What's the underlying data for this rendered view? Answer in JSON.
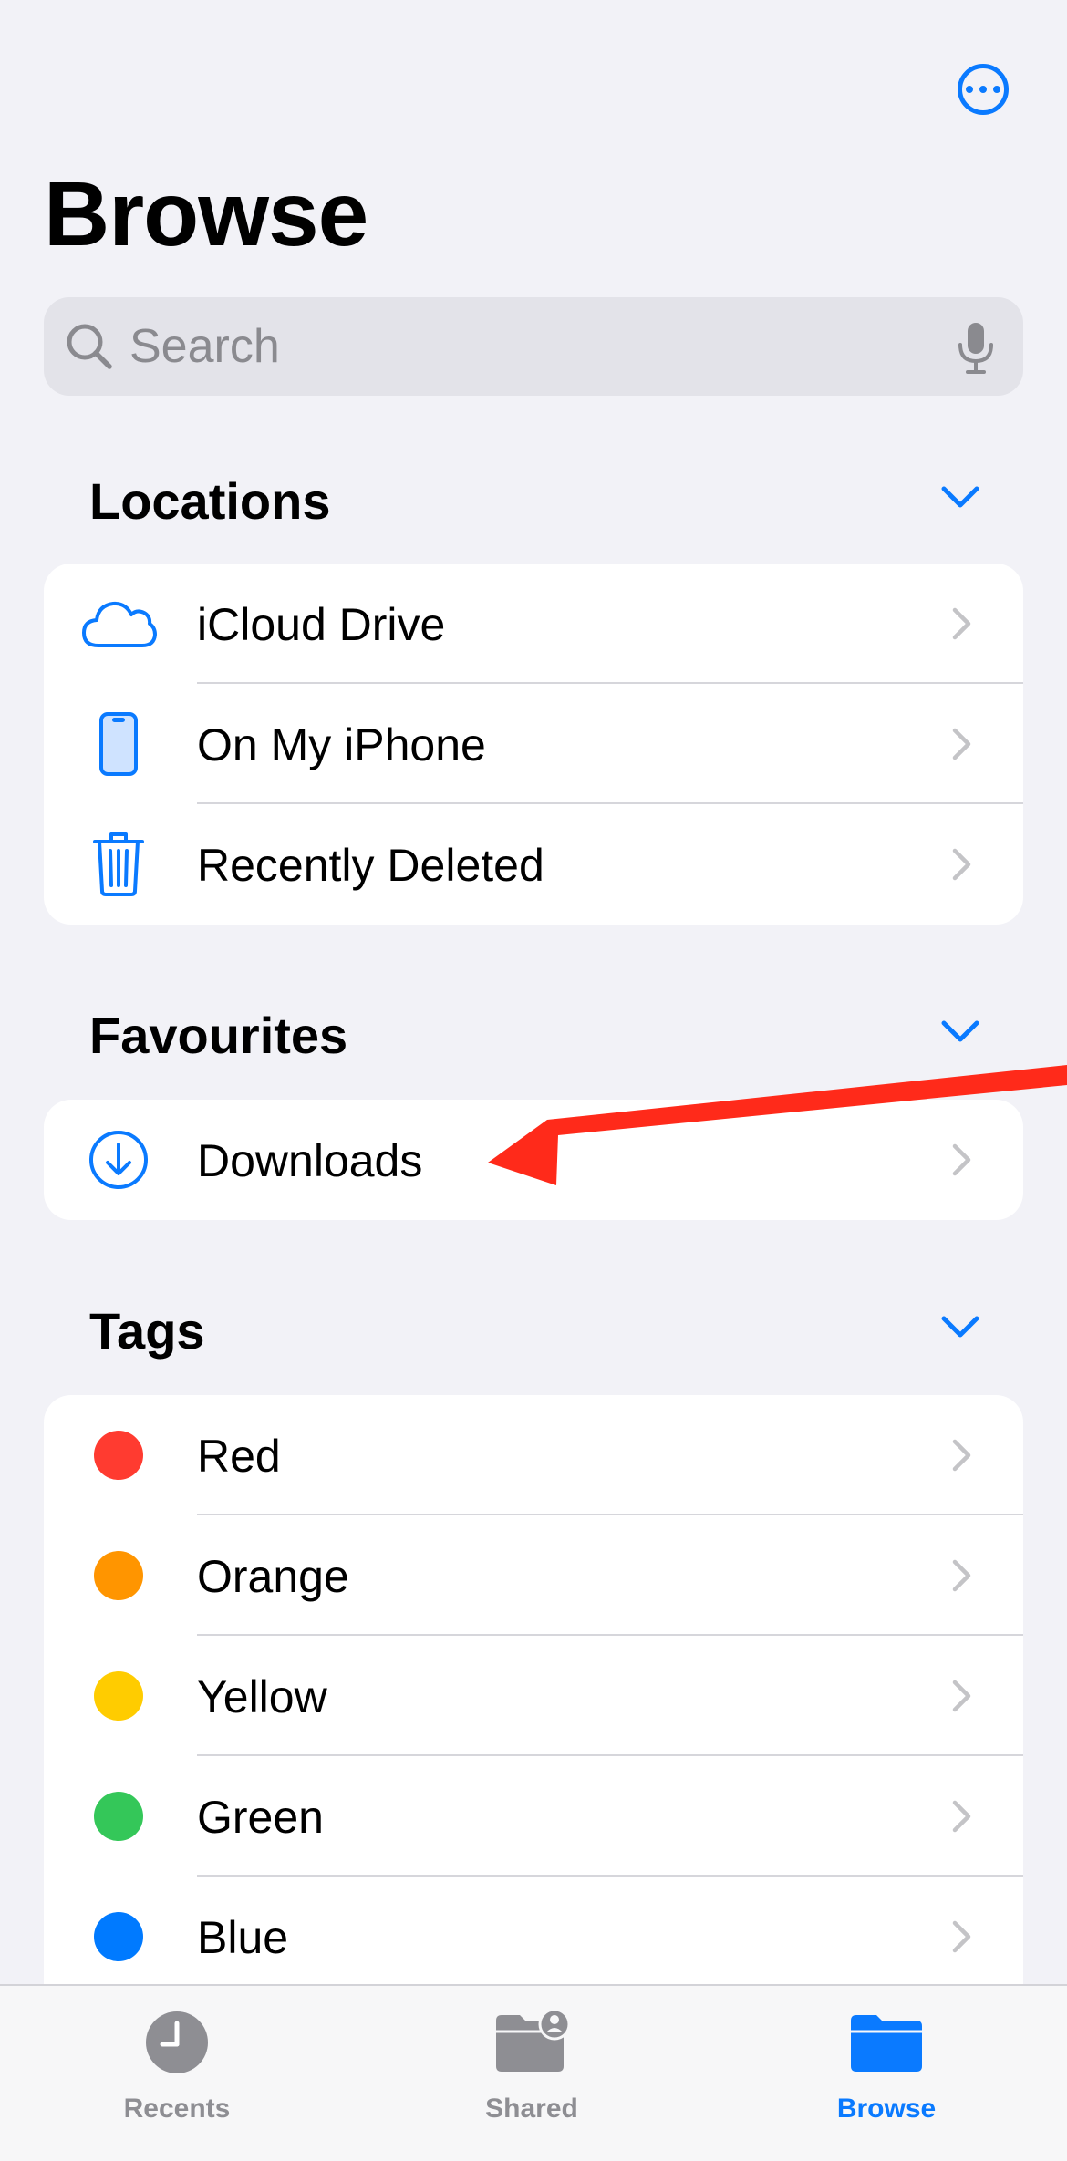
{
  "header": {
    "title": "Browse",
    "more_icon": "ellipsis-circle-icon"
  },
  "search": {
    "placeholder": "Search",
    "icon": "search-icon",
    "mic_icon": "microphone-icon"
  },
  "locations": {
    "title": "Locations",
    "items": [
      {
        "label": "iCloud Drive",
        "icon": "cloud-icon"
      },
      {
        "label": "On My iPhone",
        "icon": "iphone-icon"
      },
      {
        "label": "Recently Deleted",
        "icon": "trash-icon"
      }
    ]
  },
  "favourites": {
    "title": "Favourites",
    "items": [
      {
        "label": "Downloads",
        "icon": "download-icon"
      }
    ]
  },
  "tags": {
    "title": "Tags",
    "items": [
      {
        "label": "Red",
        "color": "#ff3b30"
      },
      {
        "label": "Orange",
        "color": "#ff9500"
      },
      {
        "label": "Yellow",
        "color": "#ffcc00"
      },
      {
        "label": "Green",
        "color": "#34c759"
      },
      {
        "label": "Blue",
        "color": "#007aff"
      }
    ]
  },
  "tab_bar": {
    "tabs": [
      {
        "label": "Recents",
        "icon": "clock-icon",
        "active": false
      },
      {
        "label": "Shared",
        "icon": "shared-folder-icon",
        "active": false
      },
      {
        "label": "Browse",
        "icon": "folder-icon",
        "active": true
      }
    ]
  },
  "colors": {
    "accent": "#0a7aff",
    "inactive": "#8e8e93",
    "annotation": "#ff2a1a"
  }
}
